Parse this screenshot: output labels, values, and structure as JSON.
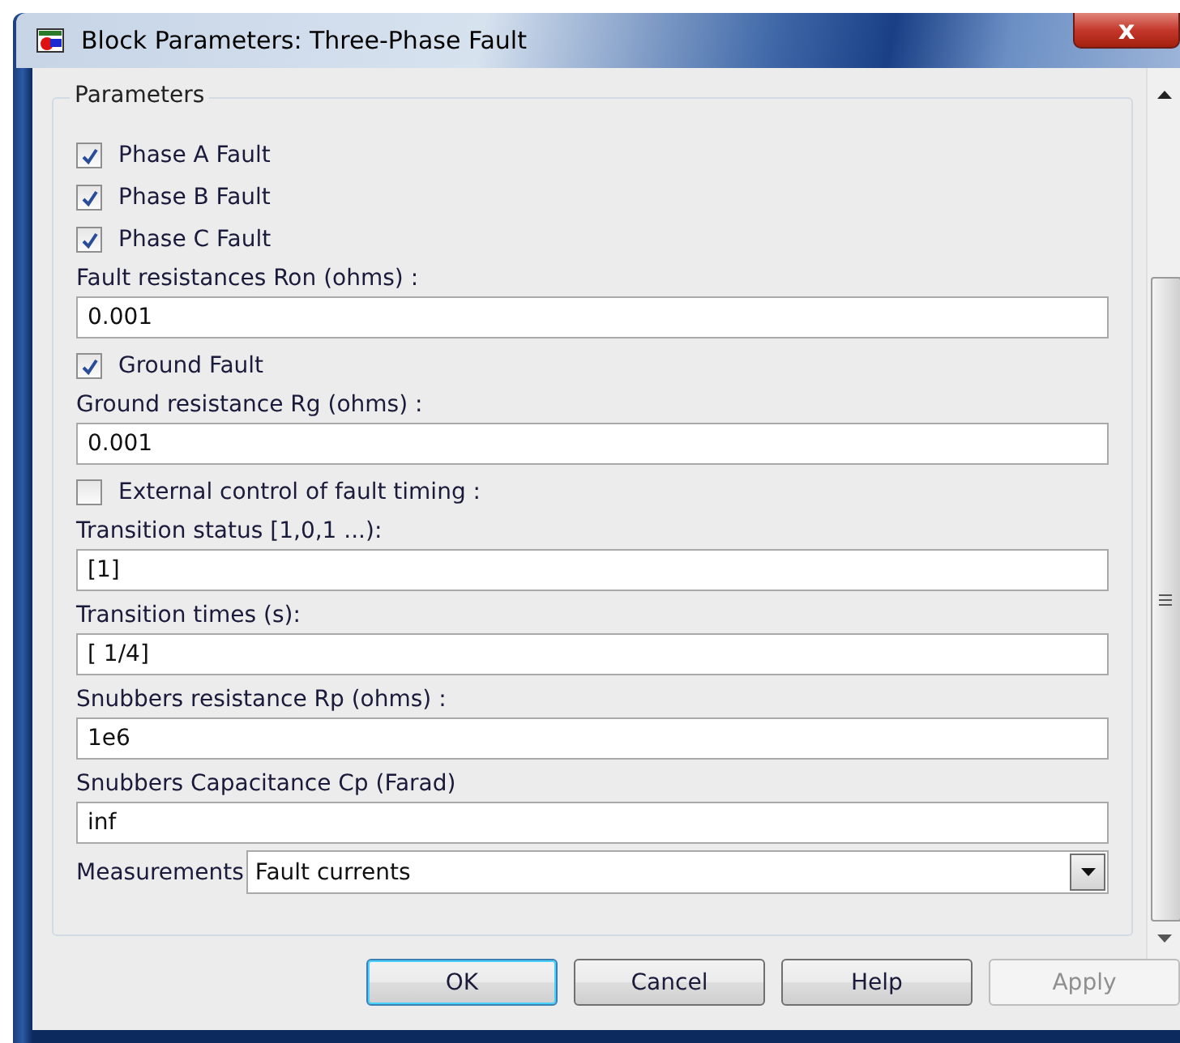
{
  "window": {
    "title": "Block Parameters: Three-Phase Fault",
    "close": "x"
  },
  "group": {
    "title": "Parameters",
    "items": [
      {
        "kind": "checkbox",
        "label": "Phase A Fault",
        "checked": true
      },
      {
        "kind": "checkbox",
        "label": "Phase B Fault",
        "checked": true
      },
      {
        "kind": "checkbox",
        "label": "Phase C Fault",
        "checked": true
      },
      {
        "kind": "field",
        "label": "Fault resistances  Ron (ohms) :",
        "value": "0.001"
      },
      {
        "kind": "checkbox",
        "label": "Ground Fault",
        "checked": true
      },
      {
        "kind": "field",
        "label": "Ground resistance Rg (ohms) :",
        "value": "0.001"
      },
      {
        "kind": "checkbox",
        "label": "External control of fault timing :",
        "checked": false
      },
      {
        "kind": "field",
        "label": "Transition status [1,0,1 ...):",
        "value": "[1]"
      },
      {
        "kind": "field",
        "label": "Transition times (s):",
        "value": "[ 1/4]"
      },
      {
        "kind": "field",
        "label": "Snubbers resistance Rp (ohms) :",
        "value": "1e6"
      },
      {
        "kind": "field",
        "label": "Snubbers Capacitance Cp (Farad)",
        "value": "inf"
      },
      {
        "kind": "dropdown",
        "label": "Measurements",
        "value": "Fault currents"
      }
    ]
  },
  "buttons": [
    {
      "label": "OK",
      "default": true,
      "disabled": false
    },
    {
      "label": "Cancel",
      "default": false,
      "disabled": false
    },
    {
      "label": "Help",
      "default": false,
      "disabled": false
    },
    {
      "label": "Apply",
      "default": false,
      "disabled": true
    }
  ]
}
